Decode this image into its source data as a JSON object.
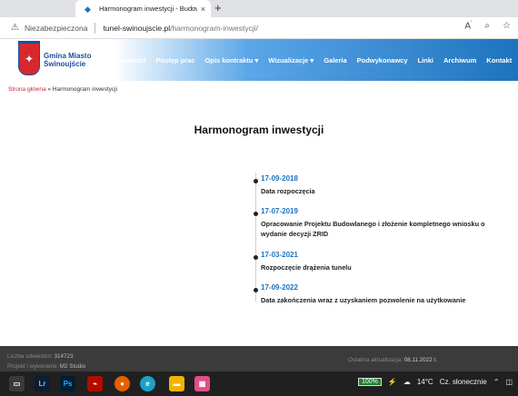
{
  "browser": {
    "tab_title": "Harmonogram inwestycji - Budow",
    "tab_close": "×",
    "new_tab": "+",
    "security_label": "Niezabezpieczona",
    "url_host": "tunel-swinoujscie.pl",
    "url_path": "/harmonogram-inwestycji/",
    "icons": [
      "read-aloud-icon",
      "zoom-icon",
      "favorites-icon"
    ]
  },
  "site": {
    "logo_text_line1": "Gmina Miasto",
    "logo_text_line2": "Świnoujście",
    "nav": [
      "Aktualności",
      "Postęp prac",
      "Opis kontraktu ▾",
      "Wizualizacje ▾",
      "Galeria",
      "Podwykonawcy",
      "Linki",
      "Archiwum",
      "Kontakt"
    ]
  },
  "breadcrumb": {
    "home": "Strona główna",
    "separator": " » ",
    "current": "Harmonogram inwestycji"
  },
  "page": {
    "title": "Harmonogram inwestycji"
  },
  "timeline": [
    {
      "date": "17-09-2018",
      "desc": "Data rozpoczęcia"
    },
    {
      "date": "17-07-2019",
      "desc": "Opracowanie Projektu Budowlanego i złożenie kompletnego wniosku o wydanie decyzji ZRID"
    },
    {
      "date": "17-03-2021",
      "desc": "Rozpoczęcie drążenia tunelu"
    },
    {
      "date": "17-09-2022",
      "desc": "Data zakończenia wraz z uzyskaniem pozwolenie na użytkowanie"
    }
  ],
  "footer": {
    "visits_label": "Liczba odwiedzin:",
    "visits_value": "314723",
    "author_label": "Projekt i wykonanie:",
    "author_value": "M2 Studio",
    "updated_label": "Ostatnia aktualizacja:",
    "updated_value": "08.11.2022 r."
  },
  "taskbar": {
    "apps": [
      "Lr",
      "Ps"
    ],
    "battery": "100%",
    "weather_temp": "14°C",
    "weather_text": "Cz. słonecznie"
  }
}
